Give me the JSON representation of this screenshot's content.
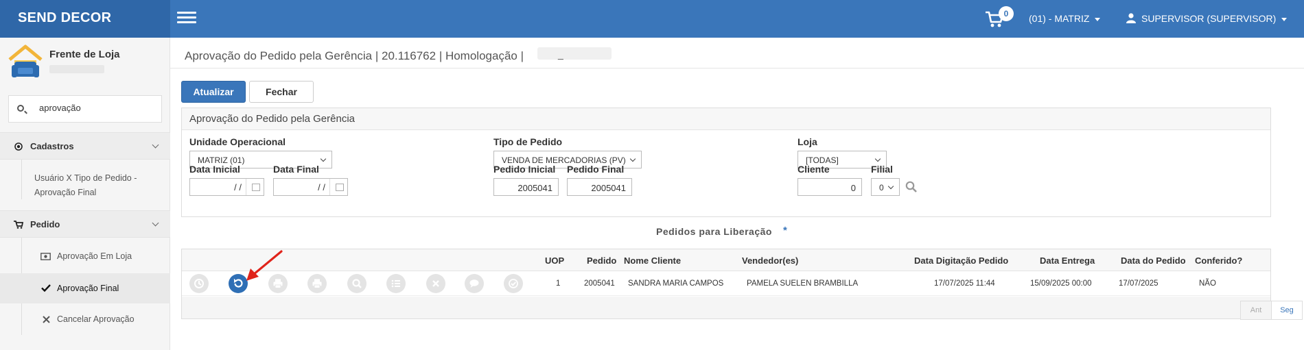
{
  "app": {
    "brand": "SEND DECOR",
    "cart_count": "0",
    "unit_menu": "(01) - MATRIZ",
    "user_menu": "SUPERVISOR (SUPERVISOR)"
  },
  "sidebar": {
    "title": "Frente de Loja",
    "search_value": "aprovação",
    "sections": [
      {
        "label": "Cadastros",
        "items": [
          {
            "label_line1": "Usuário X Tipo de Pedido -",
            "label_line2": "Aprovação Final"
          }
        ]
      },
      {
        "label": "Pedido",
        "items": [
          {
            "label": "Aprovação Em Loja",
            "icon": "money-icon"
          },
          {
            "label": "Aprovação Final",
            "icon": "check-icon"
          },
          {
            "label": "Cancelar Aprovação",
            "icon": "x-icon"
          }
        ]
      }
    ]
  },
  "page": {
    "title": "Aprovação do Pedido pela Gerência | 20.116762 | Homologação |",
    "title_suffix": "_",
    "buttons": {
      "refresh": "Atualizar",
      "close": "Fechar"
    }
  },
  "filter_panel": {
    "heading": "Aprovação do Pedido pela Gerência",
    "unidade_label": "Unidade Operacional",
    "unidade_value": "MATRIZ (01)",
    "tipo_label": "Tipo de Pedido",
    "tipo_value": "VENDA DE MERCADORIAS (PV)",
    "loja_label": "Loja",
    "loja_value": "[TODAS]",
    "data_inicial_label": "Data Inicial",
    "data_inicial_value": "/ /",
    "data_final_label": "Data Final",
    "data_final_value": "/ /",
    "pedido_inicial_label": "Pedido Inicial",
    "pedido_inicial_value": "2005041",
    "pedido_final_label": "Pedido Final",
    "pedido_final_value": "2005041",
    "cliente_label": "Cliente",
    "cliente_value": "0",
    "filial_label": "Filial",
    "filial_value": "0"
  },
  "orders": {
    "section_title": "Pedidos para Liberação",
    "section_marker": "*",
    "columns": [
      "UOP",
      "Pedido",
      "Nome Cliente",
      "Vendedor(es)",
      "Data Digitação Pedido",
      "Data Entrega",
      "Data do Pedido",
      "Conferido?"
    ],
    "rows": [
      {
        "uop": "1",
        "pedido": "2005041",
        "cliente": "SANDRA MARIA CAMPOS",
        "vendedor": "PAMELA SUELEN BRAMBILLA",
        "data_digitacao": "17/07/2025 11:44",
        "data_entrega": "15/09/2025 00:00",
        "data_pedido": "17/07/2025",
        "conferido": "NÃO"
      }
    ],
    "row_actions": [
      "history-icon",
      "undo-icon",
      "print-icon",
      "print-icon",
      "search-icon",
      "list-icon",
      "close-icon",
      "comment-icon",
      "check-icon"
    ],
    "pager": {
      "prev": "Ant",
      "next": "Seg"
    }
  },
  "colors": {
    "brand": "#2f67a8",
    "topbar": "#3a76ba",
    "accent": "#2f6fb5",
    "arrow": "#e0241b"
  }
}
